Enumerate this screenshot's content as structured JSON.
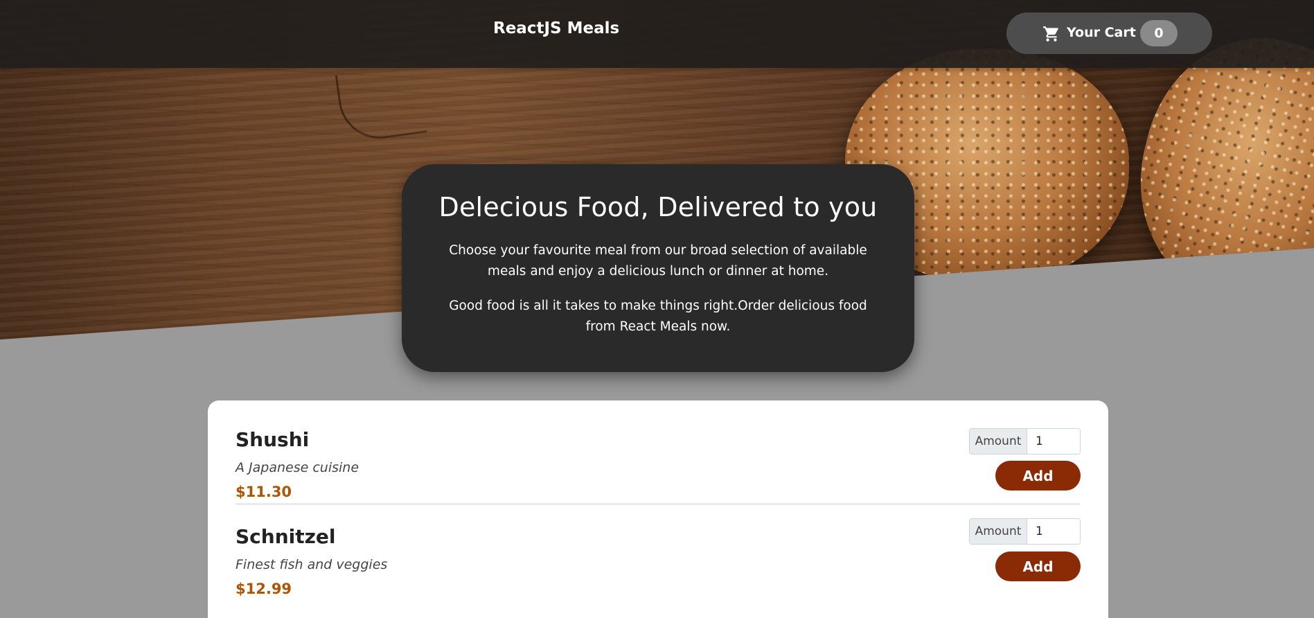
{
  "header": {
    "brand": "ReactJS Meals",
    "cart": {
      "label": "Your Cart",
      "count": "0",
      "icon": "cart-icon"
    }
  },
  "summary": {
    "title": "Delecious Food, Delivered to you",
    "paragraphs": [
      "Choose your favourite meal from our broad selection of available meals and enjoy a delicious lunch or dinner at home.",
      "Good food is all it takes to make things right.Order delicious food from React Meals now."
    ]
  },
  "meals": [
    {
      "name": "Shushi",
      "description": "A Japanese cuisine",
      "price": "$11.30",
      "amount_label": "Amount",
      "amount_value": "1",
      "add_label": "Add"
    },
    {
      "name": "Schnitzel",
      "description": "Finest fish and veggies",
      "price": "$12.99",
      "amount_label": "Amount",
      "amount_value": "1",
      "add_label": "Add"
    }
  ],
  "colors": {
    "header_bg": "#211e1c",
    "cart_button_bg": "#4d4d4d",
    "summary_bg": "#2a2a2a",
    "price": "#ad5502",
    "add_button": "#8a2b06",
    "page_bg": "#9a9a9a"
  }
}
